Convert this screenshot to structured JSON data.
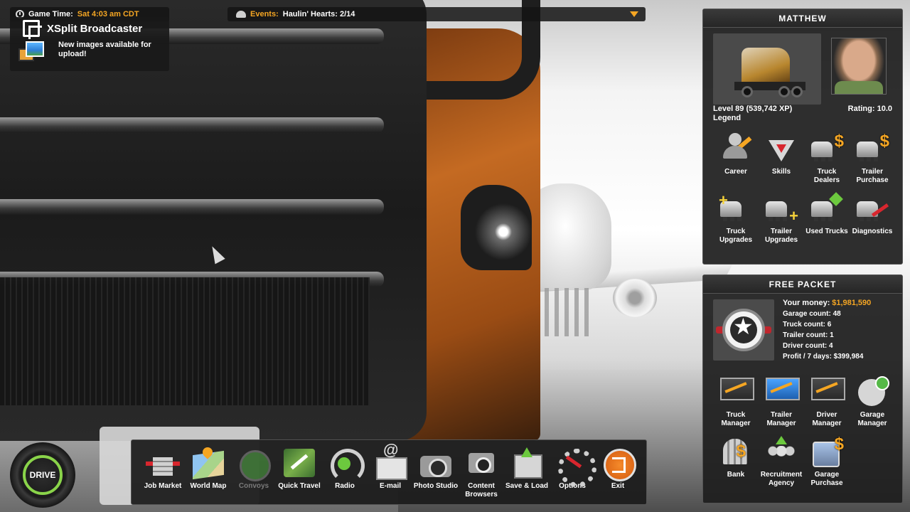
{
  "game_time": {
    "label": "Game Time:",
    "value": "Sat 4:03 am CDT"
  },
  "notification": {
    "app": "XSplit Broadcaster",
    "message": "New images available for upload!"
  },
  "events": {
    "label": "Events:",
    "value": "Haulin' Hearts: 2/14"
  },
  "profile": {
    "name": "MATTHEW",
    "level": "Level 89 (539,742 XP)",
    "rank": "Legend",
    "rating": "Rating: 10.0",
    "menu": [
      {
        "label": "Career",
        "icon": "career-icon"
      },
      {
        "label": "Skills",
        "icon": "skills-icon"
      },
      {
        "label": "Truck Dealers",
        "icon": "truck-dealers-icon"
      },
      {
        "label": "Trailer Purchase",
        "icon": "trailer-purchase-icon"
      },
      {
        "label": "Truck Upgrades",
        "icon": "truck-upgrades-icon"
      },
      {
        "label": "Trailer Upgrades",
        "icon": "trailer-upgrades-icon"
      },
      {
        "label": "Used Trucks",
        "icon": "used-trucks-icon"
      },
      {
        "label": "Diagnostics",
        "icon": "diagnostics-icon"
      }
    ]
  },
  "company": {
    "name": "FREE PACKET",
    "money_label": "Your money:",
    "money": "$1,981,590",
    "garage_count": "Garage count: 48",
    "truck_count": "Truck count: 6",
    "trailer_count": "Trailer count: 1",
    "driver_count": "Driver count: 4",
    "profit": "Profit / 7 days: $399,984",
    "menu": [
      {
        "label": "Truck Manager",
        "icon": "truck-manager-icon"
      },
      {
        "label": "Trailer Manager",
        "icon": "trailer-manager-icon"
      },
      {
        "label": "Driver Manager",
        "icon": "driver-manager-icon"
      },
      {
        "label": "Garage Manager",
        "icon": "garage-manager-icon"
      },
      {
        "label": "Bank",
        "icon": "bank-icon"
      },
      {
        "label": "Recruitment Agency",
        "icon": "recruitment-agency-icon"
      },
      {
        "label": "Garage Purchase",
        "icon": "garage-purchase-icon"
      }
    ]
  },
  "drive": {
    "label": "DRIVE",
    "accent": "#8ad44a"
  },
  "dock": [
    {
      "label": "Job Market",
      "icon": "job-market-icon"
    },
    {
      "label": "World Map",
      "icon": "world-map-icon"
    },
    {
      "label": "Convoys",
      "icon": "convoys-icon",
      "disabled": true
    },
    {
      "label": "Quick Travel",
      "icon": "quick-travel-icon"
    },
    {
      "label": "Radio",
      "icon": "radio-icon"
    },
    {
      "label": "E-mail",
      "icon": "email-icon"
    },
    {
      "label": "Photo Studio",
      "icon": "photo-studio-icon"
    },
    {
      "label": "Content Browsers",
      "icon": "content-browsers-icon"
    },
    {
      "label": "Save & Load",
      "icon": "save-load-icon"
    },
    {
      "label": "Options",
      "icon": "options-icon"
    },
    {
      "label": "Exit",
      "icon": "exit-icon"
    }
  ],
  "colors": {
    "highlight": "#f5a623",
    "panel": "#1e1e1e"
  }
}
